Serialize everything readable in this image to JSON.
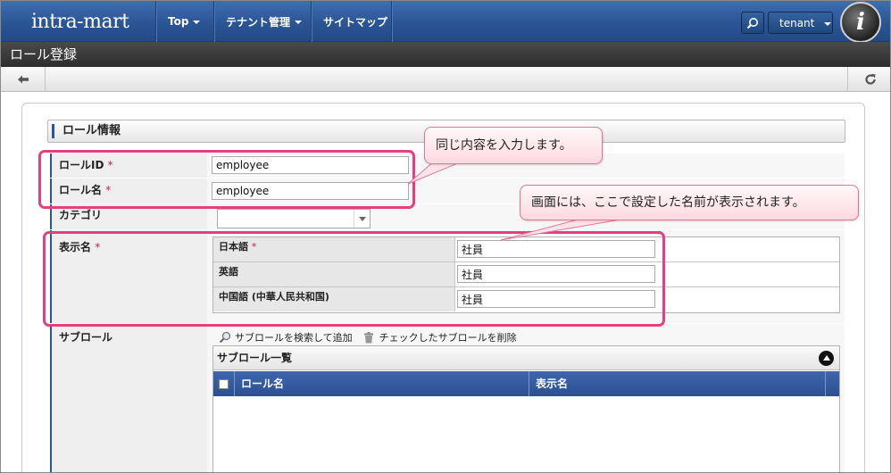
{
  "app": {
    "logo_text": "intra-mart",
    "nav": {
      "top": "Top",
      "tenant_admin": "テナント管理",
      "sitemap": "サイトマップ"
    },
    "tenant": "tenant",
    "avatar_letter": "i"
  },
  "page": {
    "title": "ロール登録"
  },
  "toolbar": {
    "back_icon": "back-arrow-icon",
    "reload_icon": "reload-icon"
  },
  "section": {
    "title": "ロール情報"
  },
  "form": {
    "role_id": {
      "label": "ロールID",
      "required": "*",
      "value": "employee"
    },
    "role_name": {
      "label": "ロール名",
      "required": "*",
      "value": "employee"
    },
    "category": {
      "label": "カテゴリ",
      "value": ""
    },
    "display_name": {
      "label": "表示名",
      "required": "*",
      "rows": [
        {
          "locale": "日本語",
          "required": "*",
          "value": "社員"
        },
        {
          "locale": "英語",
          "required": "",
          "value": "社員"
        },
        {
          "locale": "中国語 (中華人民共和国)",
          "required": "",
          "value": "社員"
        }
      ]
    },
    "sub_role": {
      "label": "サブロール",
      "search_add": "サブロールを検索して追加",
      "delete_checked": "チェックしたサブロールを削除",
      "list_title": "サブロール一覧",
      "columns": [
        "ロール名",
        "表示名"
      ]
    }
  },
  "callouts": {
    "same_input": "同じ内容を入力します。",
    "display_note": "画面には、ここで設定した名前が表示されます。"
  },
  "colors": {
    "highlight": "#e2407e",
    "nav_blue": "#2b5595",
    "accent": "#2a53a0"
  }
}
